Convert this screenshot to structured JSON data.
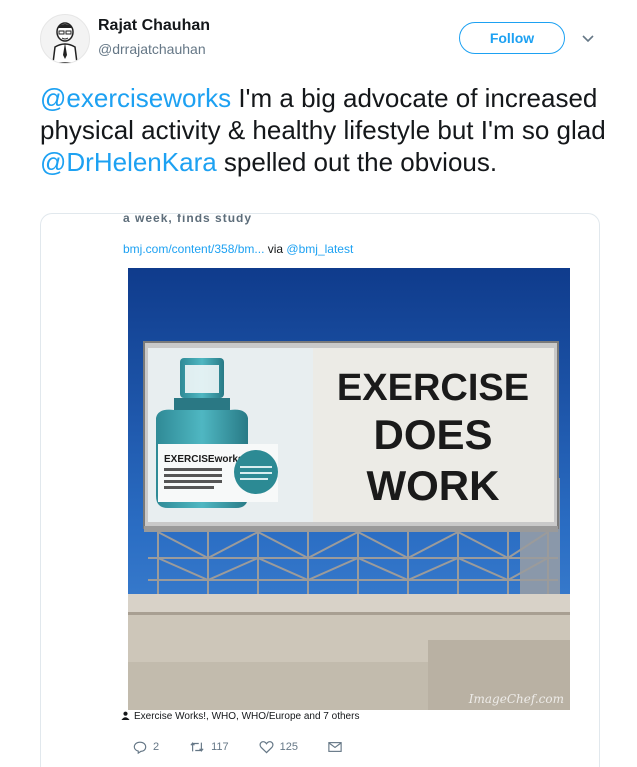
{
  "user": {
    "name": "Rajat Chauhan",
    "handle": "@drrajatchauhan"
  },
  "follow_label": "Follow",
  "tweet": {
    "mention1": "@exerciseworks",
    "text1": " I'm a big advocate of increased physical activity & healthy lifestyle but I'm so glad ",
    "mention2": "@DrHelenKara",
    "text2": " spelled out the obvious."
  },
  "embedded": {
    "cut_text": "a week, finds study",
    "link": "bmj.com/content/358/bm...",
    "via_label": " via ",
    "via_handle": "@bmj_latest",
    "image": {
      "billboard_headline": [
        "EXERCISE",
        "DOES",
        "WORK"
      ],
      "brand": "EXERCISEworks",
      "watermark": "ImageChef.com"
    },
    "credit": "Exercise Works!, WHO, WHO/Europe and 7 others",
    "stats": {
      "replies": "2",
      "retweets": "117",
      "likes": "125"
    }
  },
  "colors": {
    "accent": "#1da1f2",
    "muted": "#657786"
  }
}
